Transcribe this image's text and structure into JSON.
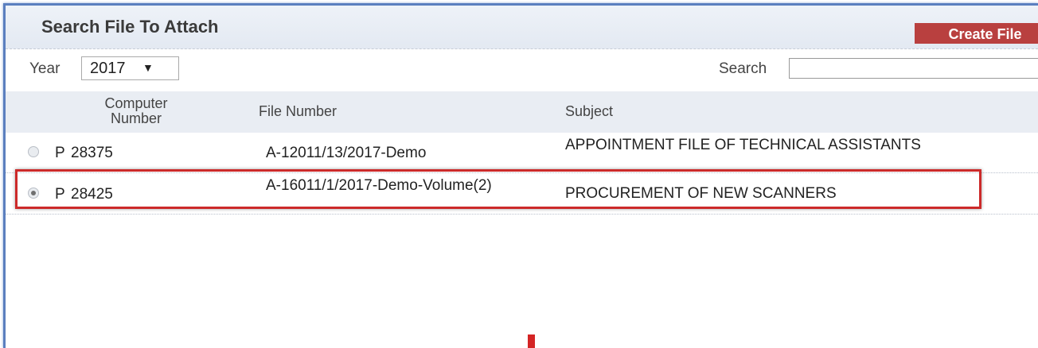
{
  "dialog": {
    "title": "Search File To Attach",
    "create_button": "Create File"
  },
  "filters": {
    "year_label": "Year",
    "year_value": "2017",
    "year_arrow": "▼",
    "search_label": "Search",
    "search_value": ""
  },
  "table": {
    "headers": {
      "computer_number": "Computer Number",
      "file_number": "File Number",
      "subject": "Subject"
    },
    "rows": [
      {
        "selected": false,
        "flag": "P",
        "computer_number": "28375",
        "file_number": "A-12011/13/2017-Demo",
        "subject": "APPOINTMENT FILE OF TECHNICAL ASSISTANTS"
      },
      {
        "selected": true,
        "flag": "P",
        "computer_number": "28425",
        "file_number": "A-16011/1/2017-Demo-Volume(2)",
        "subject": "PROCUREMENT OF NEW SCANNERS"
      }
    ]
  },
  "colors": {
    "header_bg": "#e3e9f2",
    "create_button_bg": "#b9403f",
    "highlight_border": "#cc2a2a",
    "frame_border": "#5b7fbf"
  }
}
